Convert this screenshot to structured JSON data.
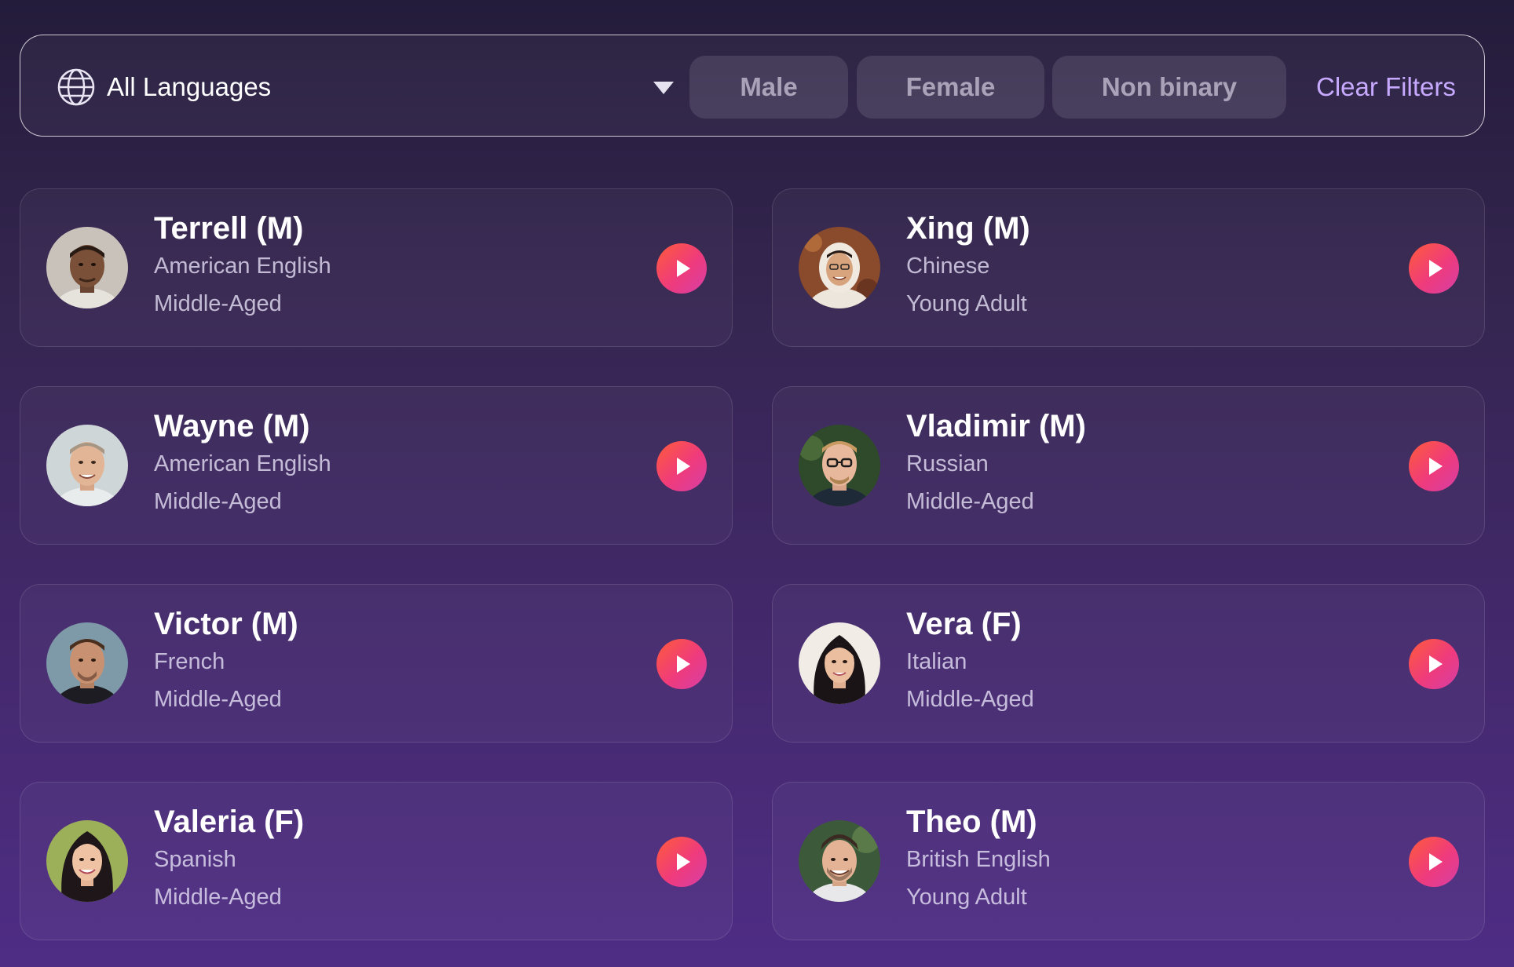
{
  "filters": {
    "language_label": "All Languages",
    "language_icon": "globe-icon",
    "dropdown_icon": "caret-down-icon",
    "gender_chips": [
      "Male",
      "Female",
      "Non binary"
    ],
    "clear_label": "Clear Filters"
  },
  "colors": {
    "accent_link": "#c7aaff",
    "play_gradient_start": "#ff5b3a",
    "play_gradient_end": "#d63ea6"
  },
  "voices": [
    {
      "name": "Terrell (M)",
      "language": "American English",
      "age": "Middle-Aged"
    },
    {
      "name": "Xing (M)",
      "language": "Chinese",
      "age": "Young Adult"
    },
    {
      "name": "Wayne (M)",
      "language": "American English",
      "age": "Middle-Aged"
    },
    {
      "name": "Vladimir (M)",
      "language": "Russian",
      "age": "Middle-Aged"
    },
    {
      "name": "Victor (M)",
      "language": "French",
      "age": "Middle-Aged"
    },
    {
      "name": "Vera (F)",
      "language": "Italian",
      "age": "Middle-Aged"
    },
    {
      "name": "Valeria (F)",
      "language": "Spanish",
      "age": "Middle-Aged"
    },
    {
      "name": "Theo (M)",
      "language": "British English",
      "age": "Young Adult"
    }
  ]
}
